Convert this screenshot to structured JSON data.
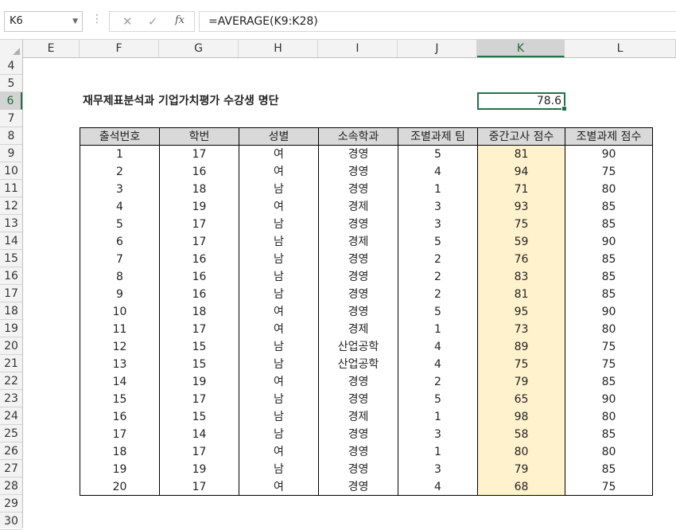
{
  "name_box": "K6",
  "formula_icons": {
    "cancel": "✕",
    "enter": "✓",
    "fx": "fx"
  },
  "formula": "=AVERAGE(K9:K28)",
  "columns": [
    "E",
    "F",
    "G",
    "H",
    "I",
    "J",
    "K",
    "L"
  ],
  "selected_column": "K",
  "rows": [
    "4",
    "5",
    "6",
    "7",
    "8",
    "9",
    "10",
    "11",
    "12",
    "13",
    "14",
    "15",
    "16",
    "17",
    "18",
    "19",
    "20",
    "21",
    "22",
    "23",
    "24",
    "25",
    "26",
    "27",
    "28",
    "29",
    "30"
  ],
  "selected_row": "6",
  "title": "재무제표분석과 기업가치평가 수강생 명단",
  "k6_value": "78.6",
  "headers": [
    "출석번호",
    "학번",
    "성별",
    "소속학과",
    "조별과제 팀",
    "중간고사 점수",
    "조별과제 점수"
  ],
  "records": [
    [
      "1",
      "17",
      "여",
      "경영",
      "5",
      "81",
      "90"
    ],
    [
      "2",
      "16",
      "여",
      "경영",
      "4",
      "94",
      "75"
    ],
    [
      "3",
      "18",
      "남",
      "경영",
      "1",
      "71",
      "80"
    ],
    [
      "4",
      "19",
      "여",
      "경제",
      "3",
      "93",
      "85"
    ],
    [
      "5",
      "17",
      "남",
      "경영",
      "3",
      "75",
      "85"
    ],
    [
      "6",
      "17",
      "남",
      "경제",
      "5",
      "59",
      "90"
    ],
    [
      "7",
      "16",
      "남",
      "경영",
      "2",
      "76",
      "85"
    ],
    [
      "8",
      "16",
      "남",
      "경영",
      "2",
      "83",
      "85"
    ],
    [
      "9",
      "16",
      "남",
      "경영",
      "2",
      "81",
      "85"
    ],
    [
      "10",
      "18",
      "여",
      "경영",
      "5",
      "95",
      "90"
    ],
    [
      "11",
      "17",
      "여",
      "경제",
      "1",
      "73",
      "80"
    ],
    [
      "12",
      "15",
      "남",
      "산업공학",
      "4",
      "89",
      "75"
    ],
    [
      "13",
      "15",
      "남",
      "산업공학",
      "4",
      "75",
      "75"
    ],
    [
      "14",
      "19",
      "여",
      "경영",
      "2",
      "79",
      "85"
    ],
    [
      "15",
      "17",
      "남",
      "경영",
      "5",
      "65",
      "90"
    ],
    [
      "16",
      "15",
      "남",
      "경제",
      "1",
      "98",
      "80"
    ],
    [
      "17",
      "14",
      "남",
      "경영",
      "3",
      "58",
      "85"
    ],
    [
      "18",
      "17",
      "여",
      "경영",
      "1",
      "80",
      "80"
    ],
    [
      "19",
      "19",
      "남",
      "경영",
      "3",
      "79",
      "85"
    ],
    [
      "20",
      "17",
      "여",
      "경영",
      "4",
      "68",
      "75"
    ]
  ],
  "colors": {
    "highlight": "#fff2cc",
    "header_fill": "#d9d9d9",
    "selection": "#217346"
  }
}
